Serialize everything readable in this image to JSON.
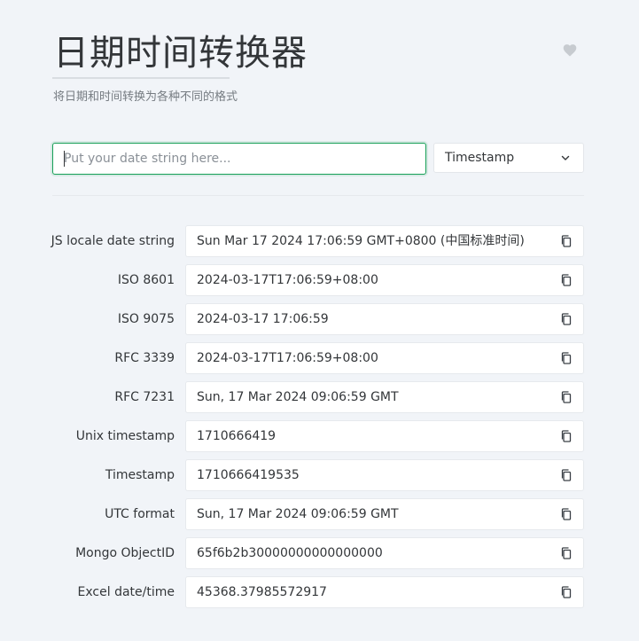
{
  "header": {
    "title": "日期时间转换器",
    "subtitle": "将日期和时间转换为各种不同的格式"
  },
  "input": {
    "placeholder": "Put your date string here...",
    "value": ""
  },
  "format_select": {
    "selected": "Timestamp"
  },
  "results": [
    {
      "label": "JS locale date string",
      "value": "Sun Mar 17 2024 17:06:59 GMT+0800 (中国标准时间)"
    },
    {
      "label": "ISO 8601",
      "value": "2024-03-17T17:06:59+08:00"
    },
    {
      "label": "ISO 9075",
      "value": "2024-03-17 17:06:59"
    },
    {
      "label": "RFC 3339",
      "value": "2024-03-17T17:06:59+08:00"
    },
    {
      "label": "RFC 7231",
      "value": "Sun, 17 Mar 2024 09:06:59 GMT"
    },
    {
      "label": "Unix timestamp",
      "value": "1710666419"
    },
    {
      "label": "Timestamp",
      "value": "1710666419535"
    },
    {
      "label": "UTC format",
      "value": "Sun, 17 Mar 2024 09:06:59 GMT"
    },
    {
      "label": "Mongo ObjectID",
      "value": "65f6b2b30000000000000000"
    },
    {
      "label": "Excel date/time",
      "value": "45368.37985572917"
    }
  ],
  "icons": {
    "favorite": "heart-icon",
    "dropdown": "chevron-down-icon",
    "copy": "copy-icon"
  },
  "colors": {
    "accent": "#18a058",
    "background": "#f1f4f8"
  }
}
